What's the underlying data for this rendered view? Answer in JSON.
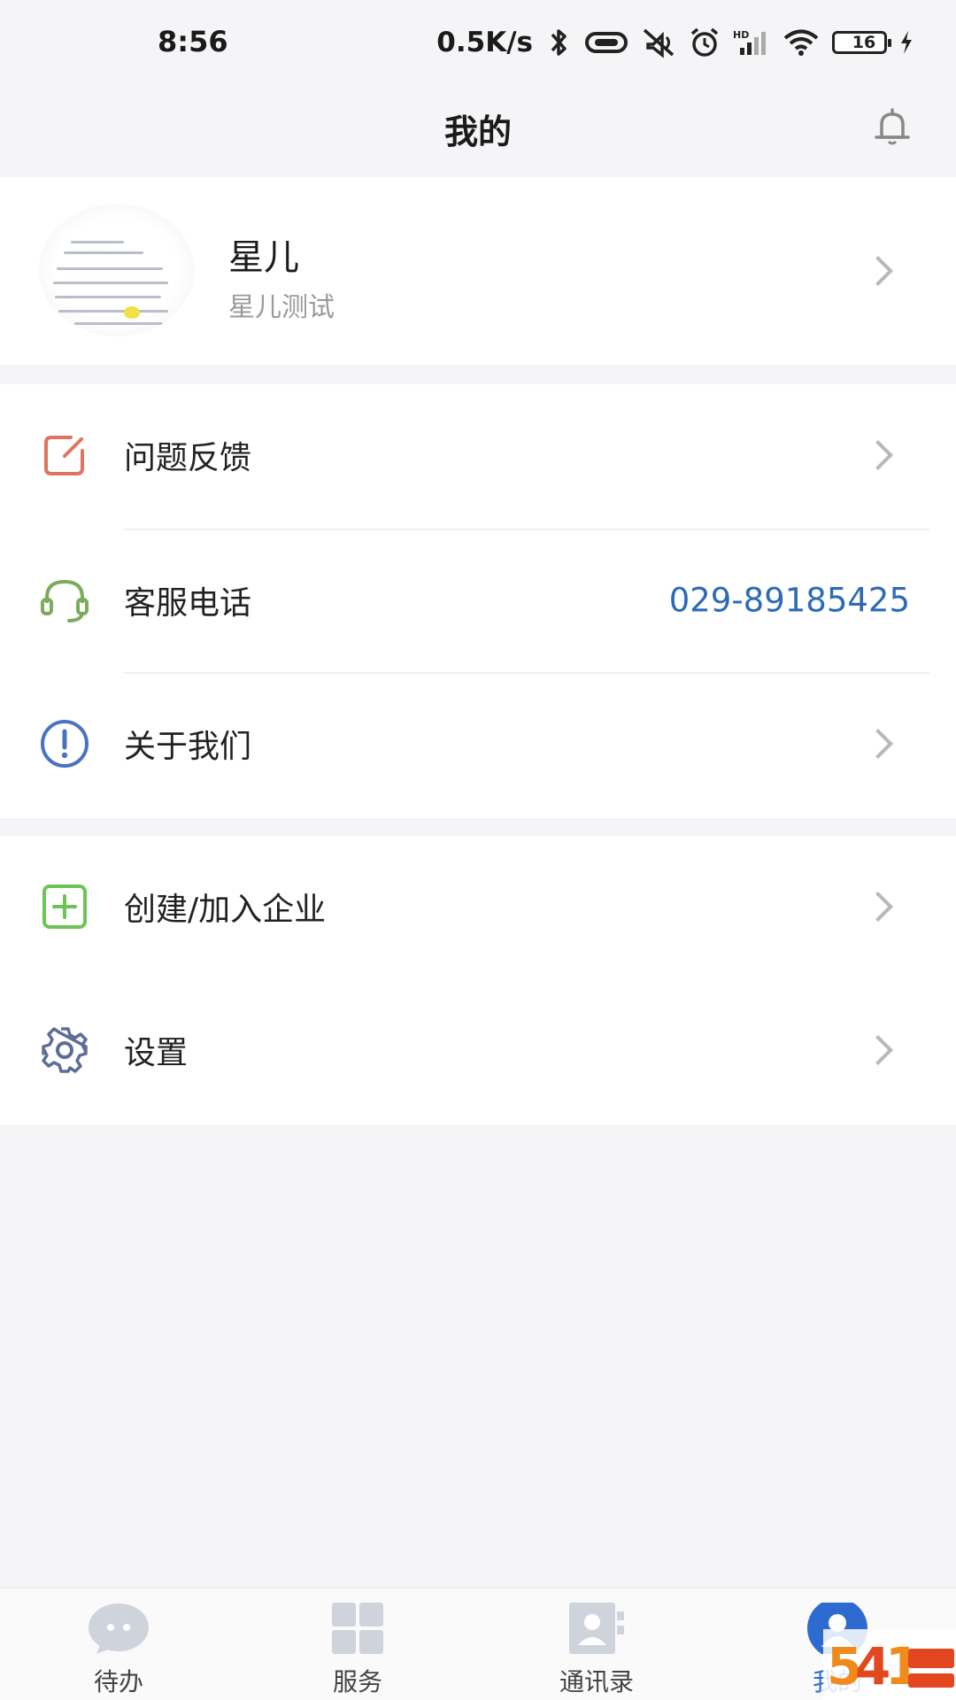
{
  "status_bar": {
    "time": "8:56",
    "net_speed": "0.5K/s",
    "battery": "16",
    "icons": [
      "bluetooth-icon",
      "nfc-icon",
      "mute-icon",
      "alarm-icon",
      "signal-icon",
      "wifi-icon",
      "battery-icon",
      "charging-icon"
    ]
  },
  "header": {
    "title": "我的",
    "bell_icon": "bell-icon"
  },
  "profile": {
    "name": "星儿",
    "subtitle": "星儿测试"
  },
  "menu": {
    "feedback": {
      "label": "问题反馈",
      "icon": "edit-icon",
      "color": "#e0735f"
    },
    "service_phone": {
      "label": "客服电话",
      "value": "029-89185425",
      "icon": "headset-icon",
      "color": "#7cab5c"
    },
    "about": {
      "label": "关于我们",
      "icon": "info-icon",
      "color": "#4a72c4"
    },
    "enterprise": {
      "label": "创建/加入企业",
      "icon": "plus-square-icon",
      "color": "#6cc456"
    },
    "settings": {
      "label": "设置",
      "icon": "gear-icon",
      "color": "#5d6d98"
    }
  },
  "tabs": [
    {
      "label": "待办",
      "icon": "chat-icon",
      "active": false
    },
    {
      "label": "服务",
      "icon": "grid-icon",
      "active": false
    },
    {
      "label": "通讯录",
      "icon": "contacts-icon",
      "active": false
    },
    {
      "label": "我的",
      "icon": "user-icon",
      "active": true
    }
  ],
  "colors": {
    "accent": "#2d6bd1",
    "phone_text": "#2d6bb5",
    "background": "#f5f5f7"
  }
}
